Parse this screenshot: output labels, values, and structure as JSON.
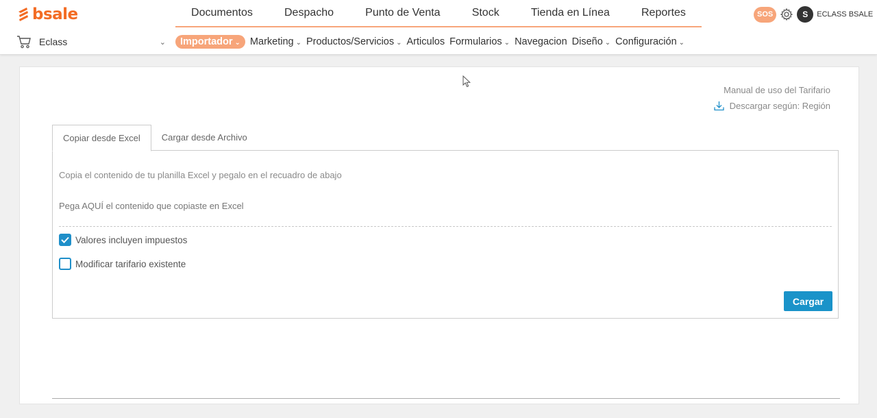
{
  "brand": {
    "name": "bsale",
    "color": "#f36c24"
  },
  "main_nav": [
    "Documentos",
    "Despacho",
    "Punto de Venta",
    "Stock",
    "Tienda en Línea",
    "Reportes"
  ],
  "user_area": {
    "sos": "SOS",
    "avatar_initial": "S",
    "user_name": "ECLASS BSALE"
  },
  "store_selector": {
    "label": "Eclass",
    "icon": "cart-icon"
  },
  "sub_nav": [
    {
      "label": "Importador",
      "dropdown": true,
      "active": true
    },
    {
      "label": "Marketing",
      "dropdown": true
    },
    {
      "label": "Productos/Servicios",
      "dropdown": true
    },
    {
      "label": "Articulos",
      "dropdown": false
    },
    {
      "label": "Formularios",
      "dropdown": true
    },
    {
      "label": "Navegacion",
      "dropdown": false
    },
    {
      "label": "Diseño",
      "dropdown": true
    },
    {
      "label": "Configuración",
      "dropdown": true
    }
  ],
  "links": {
    "manual": "Manual de uso del Tarifario",
    "download": "Descargar según: Región"
  },
  "tabs": [
    "Copiar desde Excel",
    "Cargar desde Archivo"
  ],
  "panel": {
    "hint": "Copia el contenido de tu planilla Excel y pegalo en el recuadro de abajo",
    "paste_placeholder": "Pega AQUÍ el contenido que copiaste en Excel",
    "options": [
      {
        "label": "Valores incluyen impuestos",
        "checked": true
      },
      {
        "label": "Modificar tarifario existente",
        "checked": false
      }
    ],
    "submit_label": "Cargar"
  },
  "colors": {
    "accent": "#f7a57a",
    "primary_button": "#1a93c9",
    "checkbox": "#1f8fc9"
  }
}
